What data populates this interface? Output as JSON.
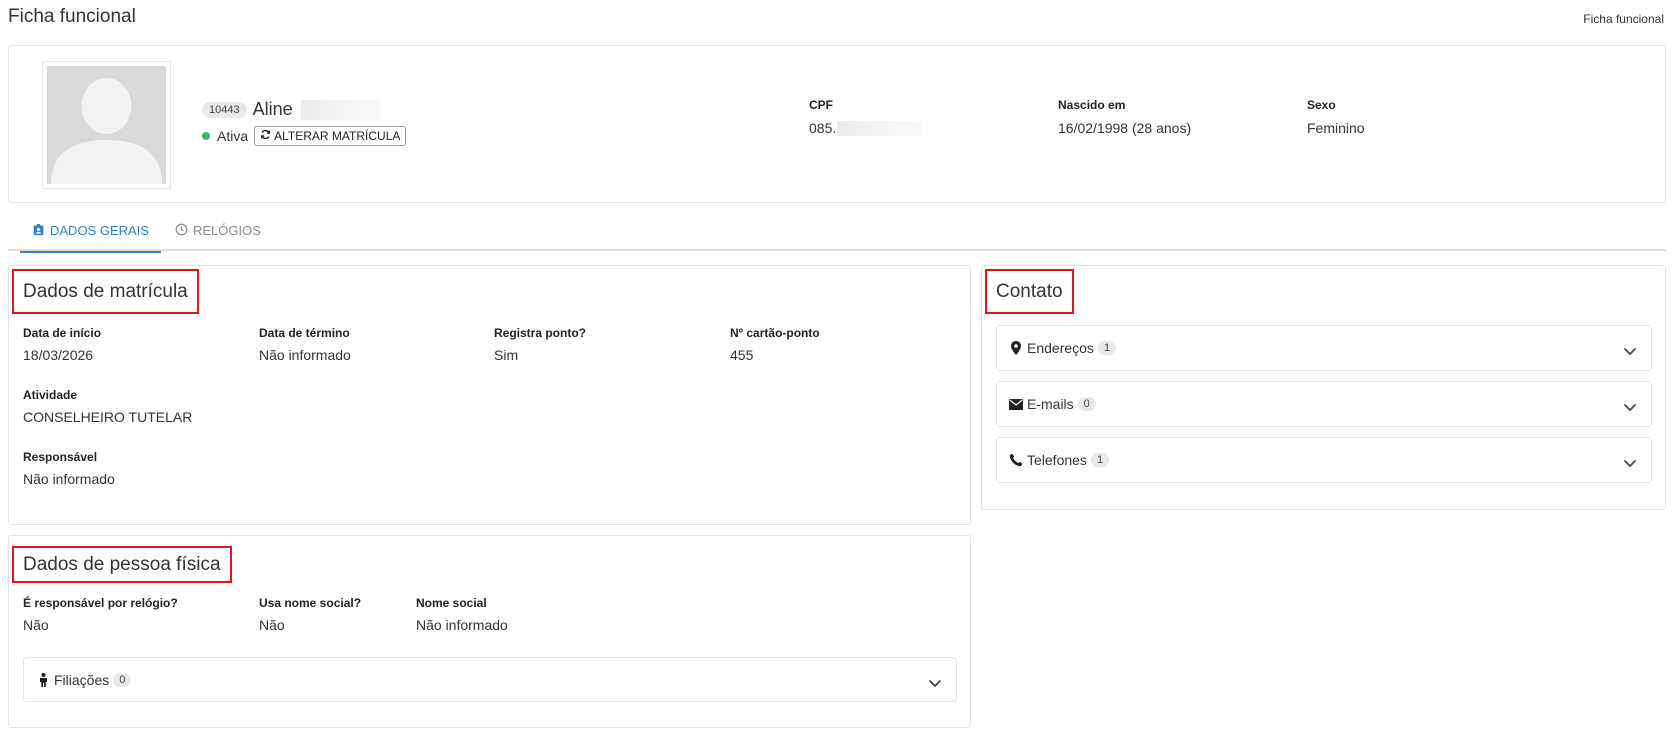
{
  "header": {
    "title": "Ficha funcional",
    "breadcrumb": "Ficha funcional"
  },
  "employee": {
    "id": "10443",
    "name": "Aline",
    "status": "Ativa",
    "status_color": "#3cb371",
    "change_button": "ALTERAR MATRÍCULA",
    "cpf_label": "CPF",
    "cpf_value": "085.",
    "birth_label": "Nascido em",
    "birth_value": "16/02/1998 (28 anos)",
    "sex_label": "Sexo",
    "sex_value": "Feminino"
  },
  "tabs": [
    {
      "label": "DADOS GERAIS",
      "icon": "id-badge-icon",
      "active": true
    },
    {
      "label": "RELÓGIOS",
      "icon": "clock-icon",
      "active": false
    }
  ],
  "matricula": {
    "title": "Dados de matrícula",
    "fields": [
      {
        "label": "Data de início",
        "value": "18/03/2026"
      },
      {
        "label": "Data de término",
        "value": "Não informado"
      },
      {
        "label": "Registra ponto?",
        "value": "Sim"
      },
      {
        "label": "Nº cartão-ponto",
        "value": "455"
      },
      {
        "label": "Atividade",
        "value": "CONSELHEIRO TUTELAR"
      },
      {
        "label": "Responsável",
        "value": "Não informado"
      }
    ]
  },
  "pessoa": {
    "title": "Dados de pessoa física",
    "fields": [
      {
        "label": "É responsável por relógio?",
        "value": "Não"
      },
      {
        "label": "Usa nome social?",
        "value": "Não"
      },
      {
        "label": "Nome social",
        "value": "Não informado"
      }
    ],
    "filiacoes": {
      "label": "Filiações",
      "count": "0",
      "icon": "person-icon"
    }
  },
  "contato": {
    "title": "Contato",
    "items": [
      {
        "label": "Endereços",
        "count": "1",
        "icon": "map-marker-icon"
      },
      {
        "label": "E-mails",
        "count": "0",
        "icon": "envelope-icon"
      },
      {
        "label": "Telefones",
        "count": "1",
        "icon": "phone-icon"
      }
    ]
  },
  "colors": {
    "accent": "#2f7fd1",
    "highlight": "#e0161e"
  }
}
